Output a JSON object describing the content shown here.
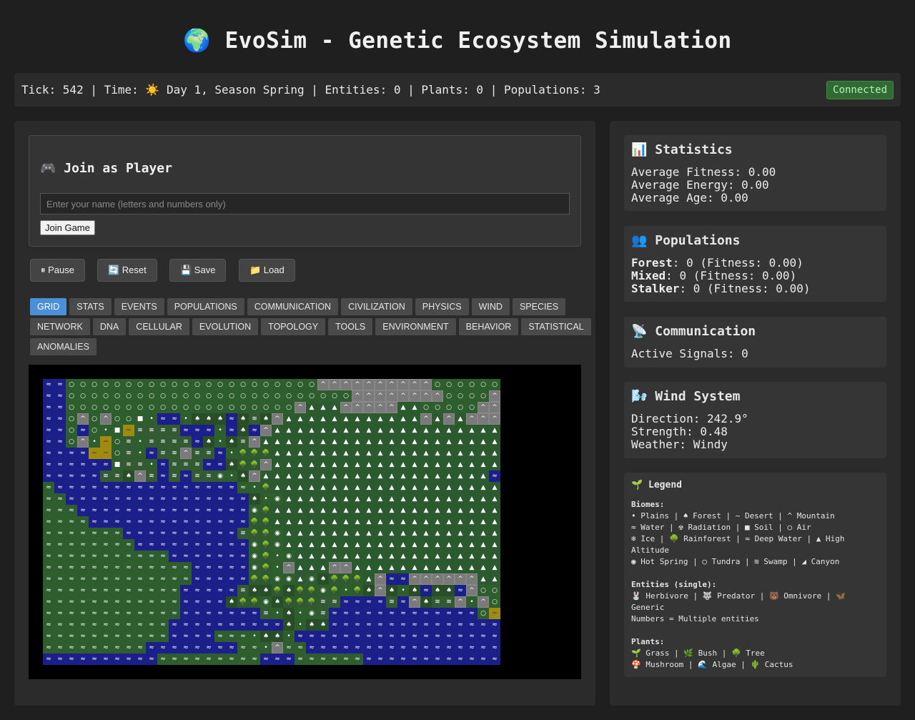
{
  "header": {
    "title": "🌍 EvoSim - Genetic Ecosystem Simulation"
  },
  "status": {
    "text": "Tick: 542 | Time: ☀️ Day 1, Season Spring | Entities: 0 | Plants: 0 | Populations: 3",
    "connection": "Connected"
  },
  "join": {
    "title": "🎮 Join as Player",
    "placeholder": "Enter your name (letters and numbers only)",
    "button": "Join Game"
  },
  "controls": {
    "pause": "⏸ Pause",
    "reset": "🔄 Reset",
    "save": "💾 Save",
    "load": "📁 Load"
  },
  "tabs": [
    "GRID",
    "STATS",
    "EVENTS",
    "POPULATIONS",
    "COMMUNICATION",
    "CIVILIZATION",
    "PHYSICS",
    "WIND",
    "SPECIES",
    "NETWORK",
    "DNA",
    "CELLULAR",
    "EVOLUTION",
    "TOPOLOGY",
    "TOOLS",
    "ENVIRONMENT",
    "BEHAVIOR",
    "STATISTICAL",
    "ANOMALIES"
  ],
  "active_tab": "GRID",
  "statistics": {
    "title": "📊 Statistics",
    "lines": [
      "Average Fitness: 0.00",
      "Average Energy: 0.00",
      "Average Age: 0.00"
    ]
  },
  "populations": {
    "title": "👥 Populations",
    "rows": [
      {
        "name": "Forest",
        "value": ": 0 (Fitness: 0.00)"
      },
      {
        "name": "Mixed",
        "value": ": 0 (Fitness: 0.00)"
      },
      {
        "name": "Stalker",
        "value": ": 0 (Fitness: 0.00)"
      }
    ]
  },
  "communication": {
    "title": "📡 Communication",
    "lines": [
      "Active Signals: 0"
    ]
  },
  "wind": {
    "title": "🌬️ Wind System",
    "lines": [
      "Direction: 242.9°",
      "Strength: 0.48",
      "Weather: Windy"
    ]
  },
  "legend": {
    "title": "🌱 Legend",
    "biomes_label": "Biomes:",
    "biomes": [
      "• Plains | ♠ Forest | ~ Desert | ^ Mountain",
      "≈ Water | ☢ Radiation | ■ Soil | ○ Air",
      "❄ Ice | 🌳 Rainforest | ≈ Deep Water | ▲ High",
      "Altitude",
      "◉ Hot Spring | ○ Tundra | ≋ Swamp | ◢ Canyon"
    ],
    "entities_label": "Entities (single):",
    "entities": [
      "🐰 Herbivore | 🐺 Predator | 🐻 Omnivore | 🦋",
      "Generic",
      "Numbers = Multiple entities"
    ],
    "plants_label": "Plants:",
    "plants": [
      "🌱 Grass | 🌿 Bush | 🌳 Tree",
      "🍄 Mushroom | 🌊 Algae | 🌵 Cactus"
    ]
  },
  "grid": {
    "cols": 40,
    "rows": [
      "ww○○○○○○○○○○○○○○○○○○○○○○mmmmmmmmmm○○○○○○○",
      "ww○○○○○○○○○○○○○○○○○○○○○○○○○mmmmmmmm○○○○mm",
      "ww○○○○○○○○○○○○○○○○○○○○m▲▲▲mmmmm▲▲○○○○○mmm",
      "ww○m○m○○■•ww•♠♠♠w♠s♠m▲▲▲▲▲▲▲▲▲▲▲▲m▲m▲mmmm",
      "ww○w○•■d≋≋s≋www•w♠wm▲▲▲▲▲▲▲▲▲▲▲▲▲▲▲▲▲▲▲▲▲",
      "ww○m•d○s•≋≋≋≋w♠•♠sm▲▲▲▲▲▲▲▲▲▲▲▲▲▲▲▲▲▲▲▲▲",
      "wwwwdd○≋•w≋≋m≋≋w•ttt▲▲▲▲▲▲▲▲▲▲▲▲▲▲▲▲▲▲▲▲",
      "wwww≈w■≋≋•w≋s≋ww♠ttm▲▲▲▲▲▲▲▲▲▲▲▲▲▲▲▲▲▲▲▲",
      "wwwww≋≋♠m≋w≋w≋≋h•♠m▲▲▲▲▲▲▲▲▲▲▲▲▲▲▲▲▲▲▲▲",
      "pwwwwwwwwwwwwwwwwp•t▲▲▲▲▲▲▲▲▲▲▲▲▲▲▲▲▲▲▲▲",
      "ppwwwwwwwwwwwwwwww♠•h▲▲▲▲▲▲▲▲▲▲▲▲▲▲▲▲▲▲▲",
      "pppwwwwwwwwwwwwwwwht▲▲▲▲▲▲▲▲▲▲▲▲▲▲▲▲▲▲▲▲",
      "ppppwwwwwwwwwwwwwwtt▲▲▲▲▲▲▲▲▲▲▲▲▲▲▲▲▲▲▲▲",
      "pppppppwwwwwwwwww≋tth▲▲▲▲▲▲▲▲▲▲▲▲▲▲▲▲▲▲▲",
      "ppppppppwwwwwwwwwwhth▲▲▲▲▲▲▲▲▲▲▲▲▲▲▲▲▲▲▲",
      "pppppppppppwwwwwwwht•h▲▲▲▲▲▲▲▲▲▲▲▲▲▲▲▲▲▲",
      "pppppppppppppwwwwwht•m▲▲▲mm▲▲▲▲▲▲▲▲▲▲▲▲▲",
      "pppppppppppppwwwwwtthh▲h♠ttt▲mwwmmmmmm▲▲▲",
      "ppppppppppppwwwww≋♠♠t♠ttht•t♠m♠•♠w♠♠wm○○m○m",
      "ppppppppppppwwww♠tth♠ttt≋≋wwww≋wm♠≋≋m•m○○○",
      "ppppppppppppwwwwwww≋•♠•h≋wwwwwwwwwwwww○dd○○",
      "pppppppppppwwwwwwwwww♠•♠♠≈≈wwwwwwwwwww≈w○○",
      "pppppppppppwwwwppp•♠♠•ww≈≈wwwwwwwwwwwwwww○",
      "pppppppppwwwwwwwwpp•mppwwwwwwwwwwwwwwwwwww",
      "wwwwwwwwwwpppppppppwwwppppppwwwwwwwwwwwwwww"
    ]
  }
}
